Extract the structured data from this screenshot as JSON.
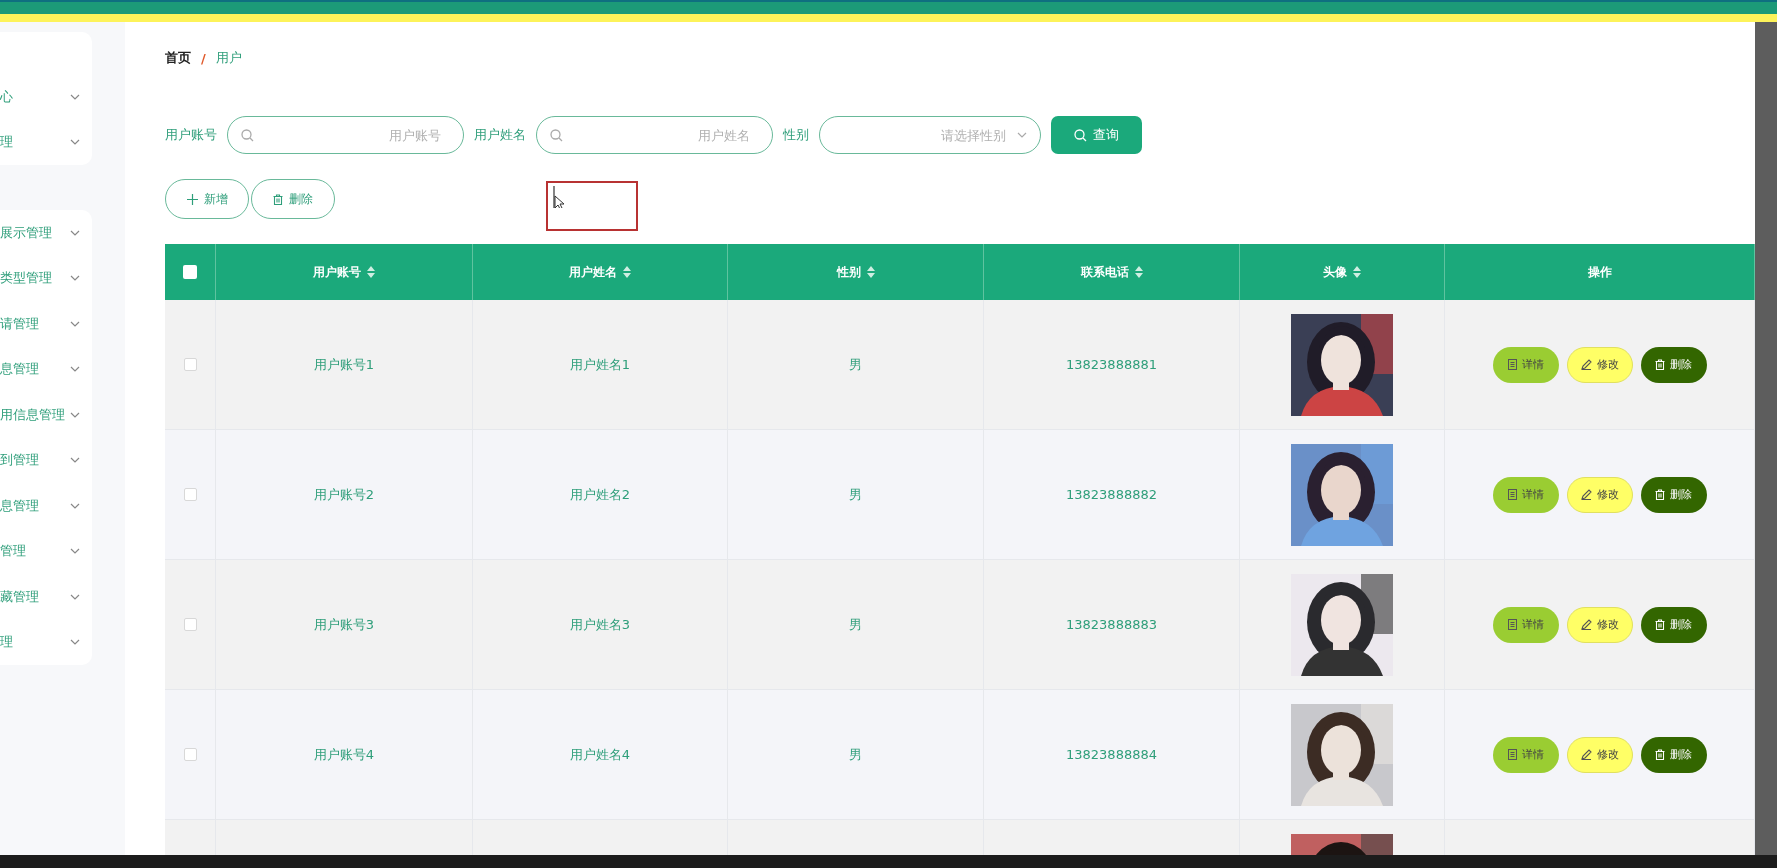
{
  "sidebar": {
    "groups": [
      {
        "items": [
          {
            "label": "心"
          },
          {
            "label": "理"
          }
        ]
      },
      {
        "items": [
          {
            "label": "展示管理"
          },
          {
            "label": "类型管理"
          },
          {
            "label": "请管理"
          },
          {
            "label": "息管理"
          },
          {
            "label": "用信息管理"
          },
          {
            "label": "到管理"
          },
          {
            "label": "息管理"
          },
          {
            "label": "管理"
          },
          {
            "label": "藏管理"
          },
          {
            "label": "理"
          }
        ]
      }
    ]
  },
  "breadcrumb": [
    {
      "label": "首页",
      "selected": false
    },
    {
      "label": "用户",
      "selected": true
    }
  ],
  "breadcrumb_separator": "/",
  "filters": [
    {
      "kind": "text",
      "label": "用户账号",
      "placeholder": "用户账号"
    },
    {
      "kind": "text",
      "label": "用户姓名",
      "placeholder": "用户姓名"
    },
    {
      "kind": "select",
      "label": "性别",
      "placeholder": "请选择性别"
    }
  ],
  "search_button": "查询",
  "actions": [
    {
      "kind": "add",
      "label": "新增"
    },
    {
      "kind": "delete",
      "label": "删除"
    }
  ],
  "table": {
    "header_checked": false,
    "columns": [
      {
        "label": "用户账号",
        "sortable": true
      },
      {
        "label": "用户姓名",
        "sortable": true
      },
      {
        "label": "性别",
        "sortable": true
      },
      {
        "label": "联系电话",
        "sortable": true
      },
      {
        "label": "头像",
        "sortable": true
      },
      {
        "label": "操作",
        "sortable": false
      }
    ],
    "rows": [
      {
        "checked": false,
        "cells": [
          "用户账号1",
          "用户姓名1",
          "男",
          "13823888881"
        ],
        "avatar": {
          "kind": "picture"
        },
        "actions": [
          {
            "kind": "detail",
            "label": "详情"
          },
          {
            "kind": "edit",
            "label": "修改"
          },
          {
            "kind": "delete",
            "label": "删除"
          }
        ]
      },
      {
        "checked": false,
        "cells": [
          "用户账号2",
          "用户姓名2",
          "男",
          "13823888882"
        ],
        "avatar": {
          "kind": "picture"
        },
        "actions": [
          {
            "kind": "detail",
            "label": "详情"
          },
          {
            "kind": "edit",
            "label": "修改"
          },
          {
            "kind": "delete",
            "label": "删除"
          }
        ]
      },
      {
        "checked": false,
        "cells": [
          "用户账号3",
          "用户姓名3",
          "男",
          "13823888883"
        ],
        "avatar": {
          "kind": "picture"
        },
        "actions": [
          {
            "kind": "detail",
            "label": "详情"
          },
          {
            "kind": "edit",
            "label": "修改"
          },
          {
            "kind": "delete",
            "label": "删除"
          }
        ]
      },
      {
        "checked": false,
        "cells": [
          "用户账号4",
          "用户姓名4",
          "男",
          "13823888884"
        ],
        "avatar": {
          "kind": "picture"
        },
        "actions": [
          {
            "kind": "detail",
            "label": "详情"
          },
          {
            "kind": "edit",
            "label": "修改"
          },
          {
            "kind": "delete",
            "label": "删除"
          }
        ]
      },
      {
        "avatar": {
          "kind": "picture"
        }
      }
    ]
  }
}
